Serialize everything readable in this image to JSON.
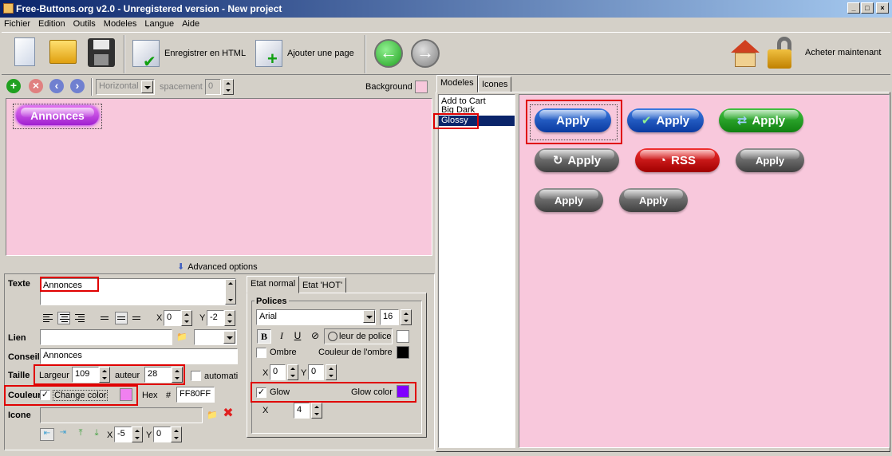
{
  "title": "Free-Buttons.org v2.0 - Unregistered version - New project",
  "menu": [
    "Fichier",
    "Edition",
    "Outils",
    "Modeles",
    "Langue",
    "Aide"
  ],
  "toolbar": {
    "save_html": "Enregistrer en HTML",
    "add_page": "Ajouter une page",
    "buy": "Acheter maintenant"
  },
  "editor_bar": {
    "orientation": "Horizontal",
    "spacing_label": "spacement",
    "spacing_value": "0",
    "background_label": "Background",
    "background_color": "#f8c8dc"
  },
  "preview": {
    "button_text": "Annonces"
  },
  "advanced_options": "Advanced options",
  "props": {
    "texte_label": "Texte",
    "texte_value": "Annonces",
    "x_label": "X",
    "x_value": "0",
    "y_label": "Y",
    "y_value": "-2",
    "lien_label": "Lien",
    "conseil_label": "Conseil",
    "conseil_value": "Annonces",
    "taille_label": "Taille",
    "largeur_label": "Largeur",
    "largeur_value": "109",
    "hauteur_label": "auteur",
    "hauteur_value": "28",
    "auto_label": "automati",
    "couleur_label": "Couleur",
    "change_color_label": "Change color",
    "change_color_value": "#f080f0",
    "hex_label": "Hex",
    "hash": "#",
    "hex_value": "FF80FF",
    "icone_label": "Icone",
    "icon_x_value": "-5",
    "icon_y_value": "0"
  },
  "state_tabs": [
    "Etat normal",
    "Etat 'HOT'"
  ],
  "polices": {
    "group_label": "Polices",
    "font": "Arial",
    "size": "16",
    "bold": "B",
    "italic": "I",
    "underline": "U",
    "font_color_label": "leur de police",
    "font_color": "#ffffff",
    "shadow_label": "Ombre",
    "shadow_color_label": "Couleur de l'ombre",
    "shadow_color": "#000000",
    "shadow_x": "0",
    "shadow_y": "0",
    "glow_label": "Glow",
    "glow_color_label": "Glow color",
    "glow_color": "#8000ff",
    "glow_x": "4"
  },
  "right_tabs": [
    "Modeles",
    "Icones"
  ],
  "models": [
    "Add to Cart",
    "Big Dark",
    "Glossy"
  ],
  "selected_model": "Glossy",
  "gallery": [
    {
      "label": "Apply",
      "style": "blue"
    },
    {
      "label": "Apply",
      "style": "blue-check"
    },
    {
      "label": "Apply",
      "style": "green-refresh"
    },
    {
      "label": "Apply",
      "style": "gray-refresh"
    },
    {
      "label": "RSS",
      "style": "red-rss"
    },
    {
      "label": "Apply",
      "style": "gray"
    },
    {
      "label": "Apply",
      "style": "gray"
    },
    {
      "label": "Apply",
      "style": "gray"
    }
  ]
}
